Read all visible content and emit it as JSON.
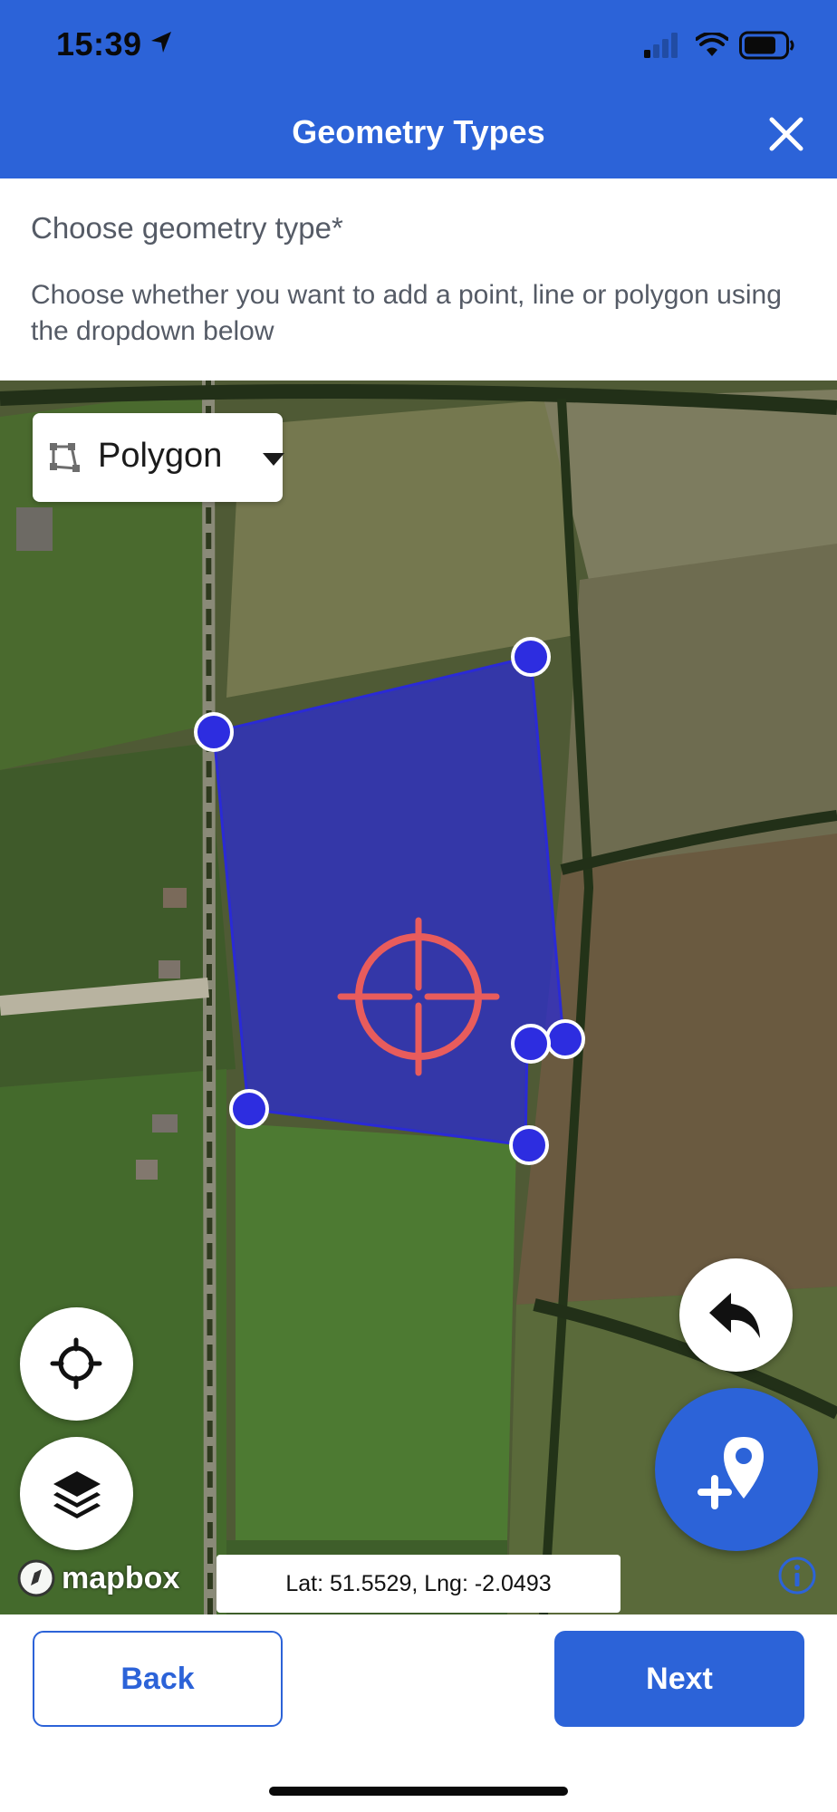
{
  "status_bar": {
    "time": "15:39",
    "icons": [
      "location-arrow-icon",
      "cellular-signal-icon",
      "wifi-icon",
      "battery-icon"
    ]
  },
  "header": {
    "title": "Geometry Types",
    "close_icon": "close-icon"
  },
  "intro": {
    "question": "Choose geometry type*",
    "hint": "Choose whether you want to add a point, line or polygon using the dropdown below"
  },
  "map": {
    "geometry_select": {
      "selected": "Polygon",
      "icon": "polygon-icon"
    },
    "coords_label": "Lat: 51.5529, Lng: -2.0493",
    "attribution": "mapbox",
    "buttons": {
      "undo": "undo-icon",
      "locate": "locate-icon",
      "layers": "layers-icon",
      "add_point": "add-point-icon"
    },
    "polygon_fill_color": "#2a2ad6",
    "vertex_color": "#2d2de0",
    "crosshair_color": "#e85c5c"
  },
  "footer": {
    "back_label": "Back",
    "next_label": "Next"
  },
  "colors": {
    "primary": "#2c63d8"
  }
}
